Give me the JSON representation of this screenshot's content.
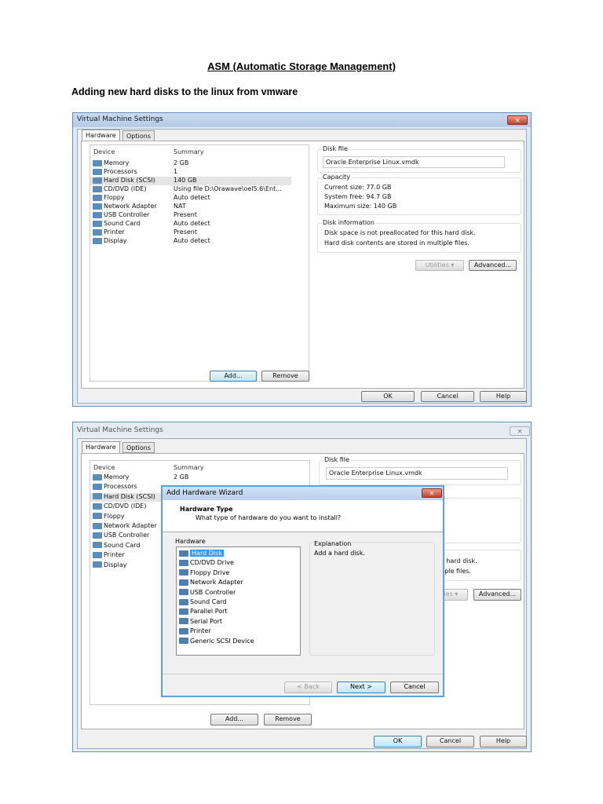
{
  "document": {
    "title": "ASM (Automatic Storage Management)",
    "subtitle": "Adding new hard disks to the linux from vmware"
  },
  "vm_settings": {
    "window_title": "Virtual Machine Settings",
    "close_icon": "×",
    "tabs": [
      "Hardware",
      "Options"
    ],
    "columns": [
      "Device",
      "Summary"
    ],
    "devices": [
      {
        "name": "Memory",
        "summary": "2 GB",
        "icon": "memory-icon"
      },
      {
        "name": "Processors",
        "summary": "1",
        "icon": "processor-icon"
      },
      {
        "name": "Hard Disk (SCSI)",
        "summary": "140 GB",
        "icon": "hard-disk-icon"
      },
      {
        "name": "CD/DVD (IDE)",
        "summary": "Using file D:\\Orawave\\oel5.6\\Ent...",
        "icon": "cd-dvd-icon"
      },
      {
        "name": "Floppy",
        "summary": "Auto detect",
        "icon": "floppy-icon"
      },
      {
        "name": "Network Adapter",
        "summary": "NAT",
        "icon": "network-adapter-icon"
      },
      {
        "name": "USB Controller",
        "summary": "Present",
        "icon": "usb-icon"
      },
      {
        "name": "Sound Card",
        "summary": "Auto detect",
        "icon": "sound-card-icon"
      },
      {
        "name": "Printer",
        "summary": "Present",
        "icon": "printer-icon"
      },
      {
        "name": "Display",
        "summary": "Auto detect",
        "icon": "display-icon"
      }
    ],
    "disk_file": {
      "label": "Disk file",
      "value": "Oracle Enterprise Linux.vmdk"
    },
    "capacity": {
      "label": "Capacity",
      "current": "Current size:  77.0 GB",
      "free": "System free:  94.7 GB",
      "max": "Maximum size:  140 GB"
    },
    "disk_info": {
      "label": "Disk information",
      "line1": "Disk space is not preallocated for this hard disk.",
      "line2": "Hard disk contents are stored in multiple files."
    },
    "buttons": {
      "utilities": "Utilities  ▾",
      "advanced": "Advanced...",
      "add": "Add...",
      "remove": "Remove",
      "ok": "OK",
      "cancel": "Cancel",
      "help": "Help"
    }
  },
  "wizard": {
    "title": "Add Hardware Wizard",
    "close_icon": "×",
    "heading": "Hardware Type",
    "question": "What type of hardware do you want to install?",
    "hardware_label": "Hardware",
    "items": [
      "Hard Disk",
      "CD/DVD Drive",
      "Floppy Drive",
      "Network Adapter",
      "USB Controller",
      "Sound Card",
      "Parallel Port",
      "Serial Port",
      "Printer",
      "Generic SCSI Device"
    ],
    "selected": "Hard Disk",
    "explanation_label": "Explanation",
    "explanation": "Add a hard disk.",
    "buttons": {
      "back": "< Back",
      "next": "Next >",
      "cancel": "Cancel"
    }
  }
}
